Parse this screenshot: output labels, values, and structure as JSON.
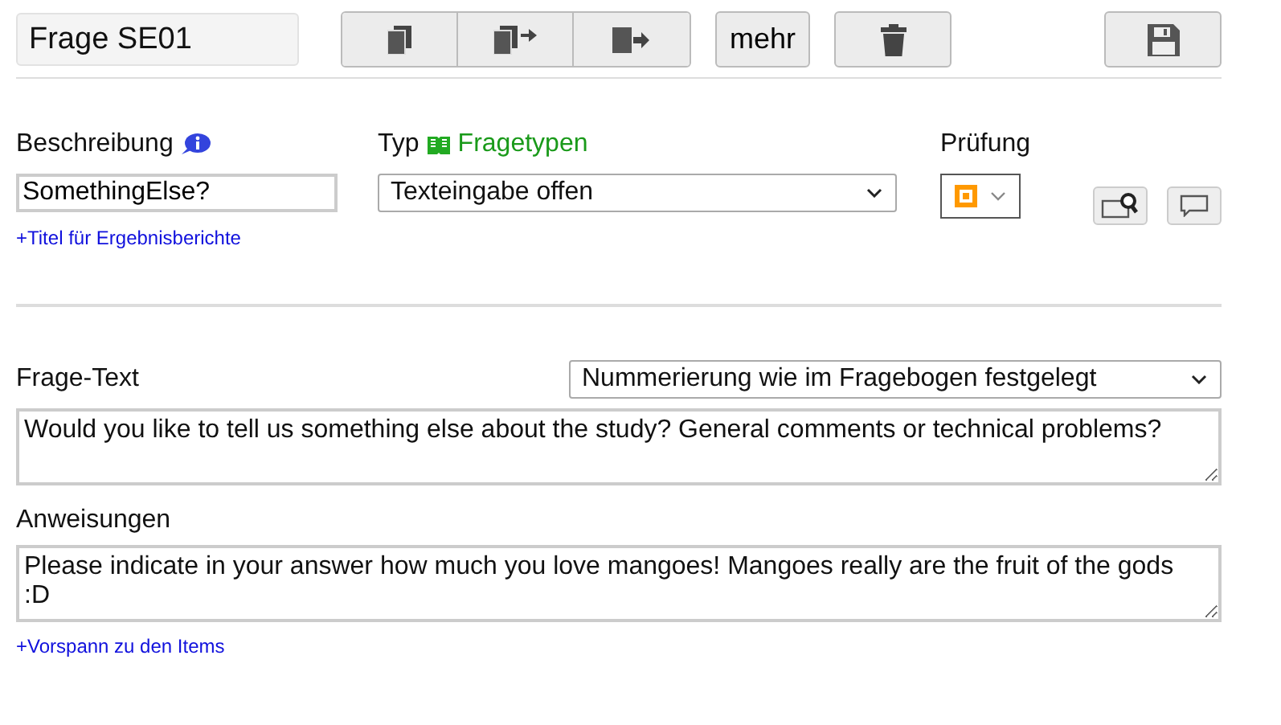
{
  "title": "Frage SE01",
  "more_button": "mehr",
  "description": {
    "label": "Beschreibung",
    "value": "SomethingElse?",
    "link": "+Titel für Ergebnisberichte"
  },
  "type": {
    "label": "Typ",
    "link": "Fragetypen",
    "value": "Texteingabe offen"
  },
  "check": {
    "label": "Prüfung"
  },
  "question_text": {
    "label": "Frage-Text",
    "numbering": "Nummerierung wie im Fragebogen festgelegt",
    "value": "Would you like to tell us something else about the study? General comments or technical problems?"
  },
  "instructions": {
    "label": "Anweisungen",
    "value": "Please indicate in your answer how much you love mangoes! Mangoes really are the fruit of the gods :D",
    "link": "+Vorspann zu den Items"
  }
}
